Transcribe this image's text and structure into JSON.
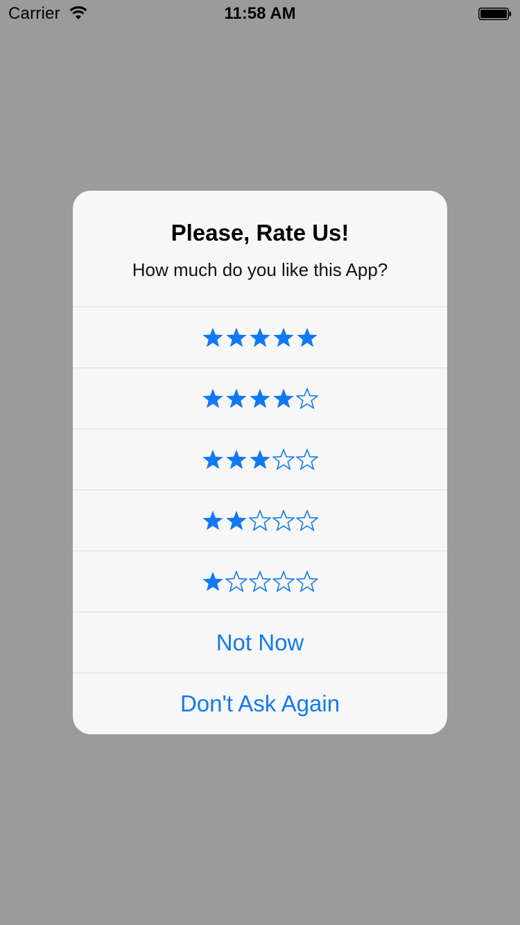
{
  "status_bar": {
    "carrier": "Carrier",
    "time": "11:58 AM",
    "wifi_icon": "wifi-icon",
    "battery_icon": "battery-icon",
    "battery_level": 1.0
  },
  "alert": {
    "title": "Please, Rate Us!",
    "message": "How much do you like this App?",
    "ratings": [
      {
        "filled": 5,
        "empty": 0
      },
      {
        "filled": 4,
        "empty": 1
      },
      {
        "filled": 3,
        "empty": 2
      },
      {
        "filled": 2,
        "empty": 3
      },
      {
        "filled": 1,
        "empty": 4
      }
    ],
    "not_now_label": "Not Now",
    "dont_ask_label": "Don't Ask Again"
  },
  "colors": {
    "accent": "#1179f3",
    "dimmed_background": "#9b9b9b",
    "alert_background": "#f7f7f7",
    "separator": "#dbdbdb"
  }
}
